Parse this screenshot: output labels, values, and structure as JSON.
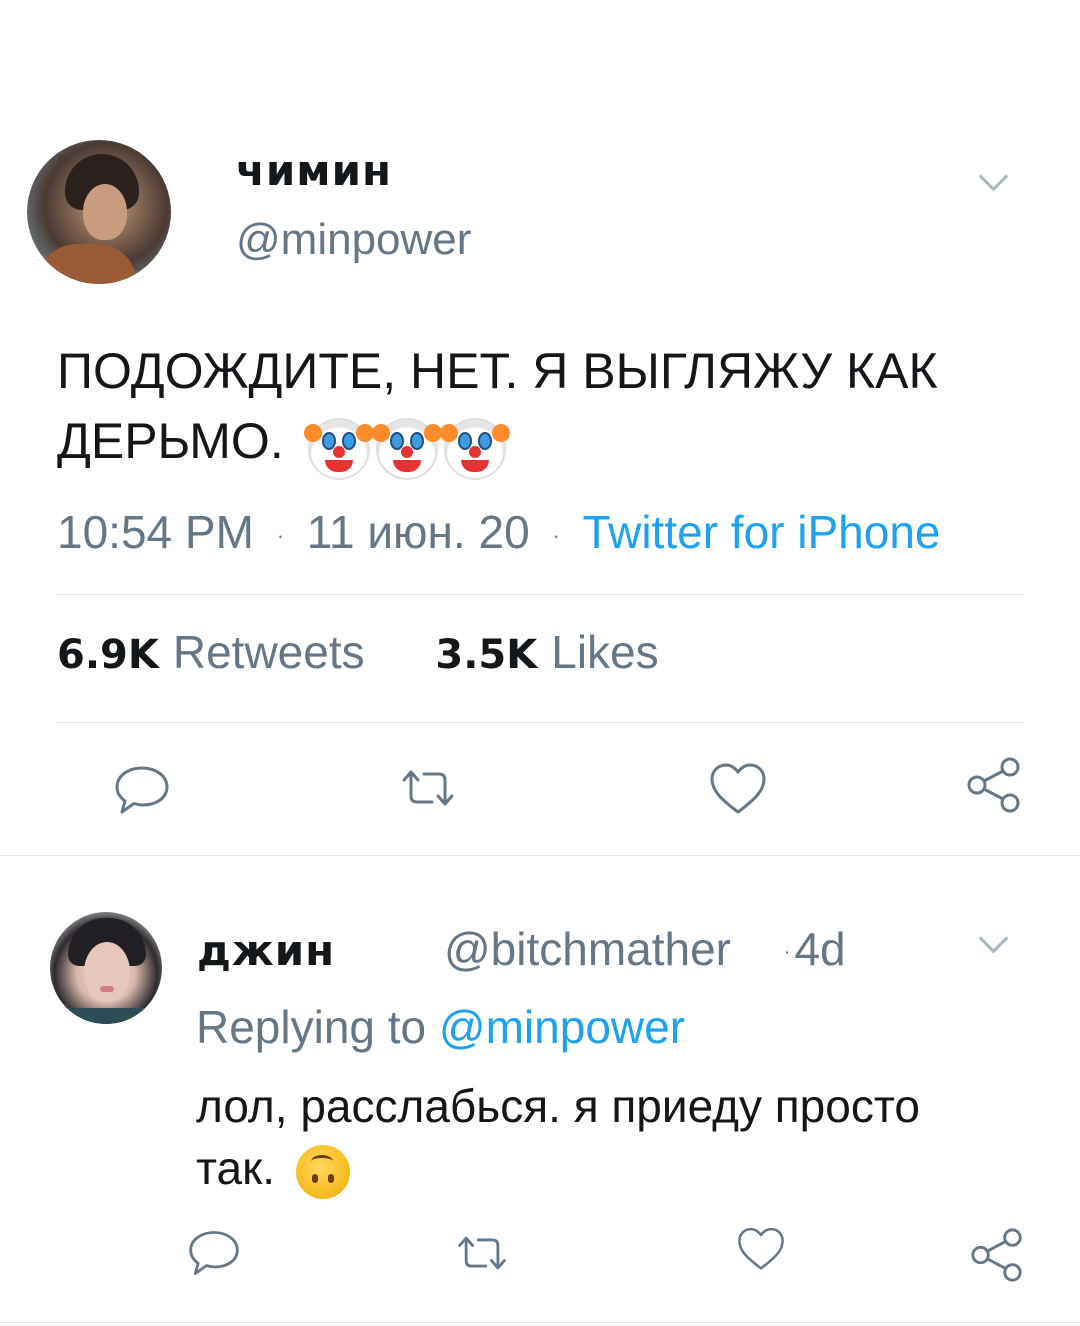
{
  "main_tweet": {
    "display_name": "чимин",
    "handle": "@minpower",
    "text": "ПОДОЖДИТЕ, НЕТ. Я ВЫГЛЯЖУ КАК ДЕРЬМО.",
    "emoji": [
      "clown-face",
      "clown-face",
      "clown-face"
    ],
    "time": "10:54 PM",
    "date": "11 июн. 20",
    "source": "Twitter for iPhone",
    "separator": "·",
    "retweets_count": "6.9K",
    "retweets_label": "Retweets",
    "likes_count": "3.5K",
    "likes_label": "Likes",
    "actions": [
      "reply-icon",
      "retweet-icon",
      "like-icon",
      "share-icon"
    ]
  },
  "reply_tweet": {
    "display_name": "джин",
    "handle": "@bitchmather",
    "separator": "·",
    "time_ago": "4d",
    "replying_label": "Replying to",
    "replying_mention": "@minpower",
    "text": "лол, расслабься. я приеду просто так.",
    "emoji": "upside-down-face",
    "actions": [
      "reply-icon",
      "retweet-icon",
      "like-icon",
      "share-icon"
    ]
  },
  "colors": {
    "text_primary": "#14171a",
    "text_secondary": "#657786",
    "link_blue": "#1da1f2",
    "icon_gray": "#657786",
    "divider": "#e1e8ed"
  }
}
